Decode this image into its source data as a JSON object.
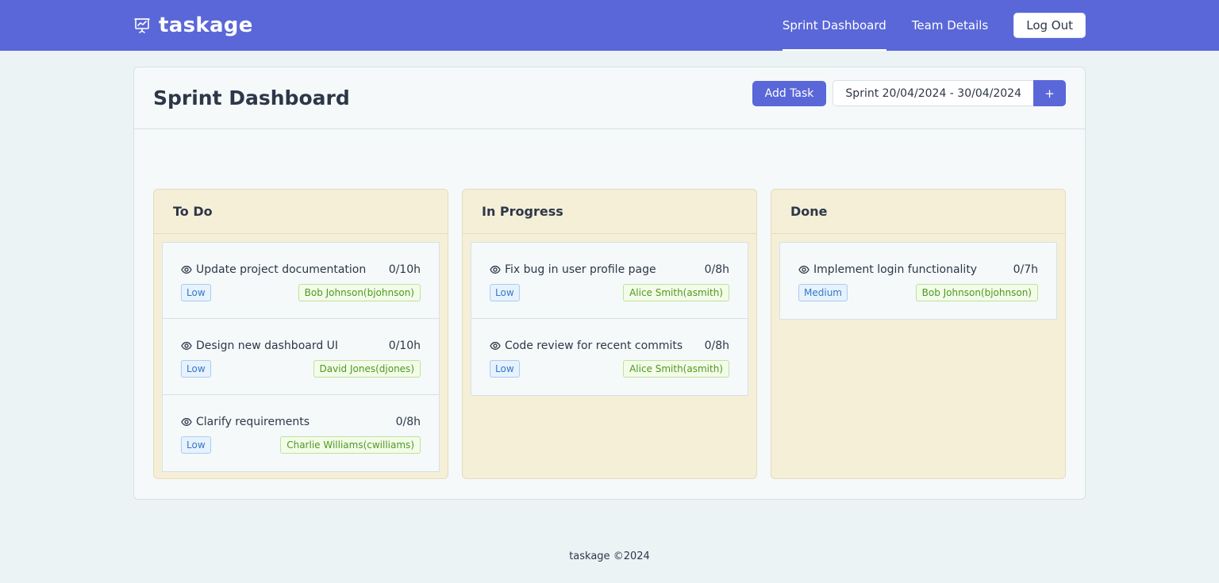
{
  "brand": {
    "name": "taskage",
    "icon": "presentation-chart-icon"
  },
  "nav": {
    "links": [
      {
        "label": "Sprint Dashboard",
        "active": true
      },
      {
        "label": "Team Details",
        "active": false
      }
    ],
    "logout_label": "Log Out"
  },
  "page": {
    "title": "Sprint Dashboard"
  },
  "toolbar": {
    "add_task_label": "Add Task",
    "sprint_label": "Sprint 20/04/2024 - 30/04/2024",
    "add_sprint_label": "+"
  },
  "columns": [
    {
      "title": "To Do",
      "tasks": [
        {
          "name": "Update project documentation",
          "hours": "0/10h",
          "priority": "Low",
          "assignee": "Bob Johnson(bjohnson)"
        },
        {
          "name": "Design new dashboard UI",
          "hours": "0/10h",
          "priority": "Low",
          "assignee": "David Jones(djones)"
        },
        {
          "name": "Clarify requirements",
          "hours": "0/8h",
          "priority": "Low",
          "assignee": "Charlie Williams(cwilliams)"
        }
      ]
    },
    {
      "title": "In Progress",
      "tasks": [
        {
          "name": "Fix bug in user profile page",
          "hours": "0/8h",
          "priority": "Low",
          "assignee": "Alice Smith(asmith)"
        },
        {
          "name": "Code review for recent commits",
          "hours": "0/8h",
          "priority": "Low",
          "assignee": "Alice Smith(asmith)"
        }
      ]
    },
    {
      "title": "Done",
      "tasks": [
        {
          "name": "Implement login functionality",
          "hours": "0/7h",
          "priority": "Medium",
          "assignee": "Bob Johnson(bjohnson)"
        }
      ]
    }
  ],
  "footer": {
    "text": "taskage ©2024"
  },
  "colors": {
    "primary": "#5a67d8",
    "column_bg": "#f5efd8",
    "priority_tag": "#3578c8",
    "assignee_tag": "#4e9a22"
  }
}
